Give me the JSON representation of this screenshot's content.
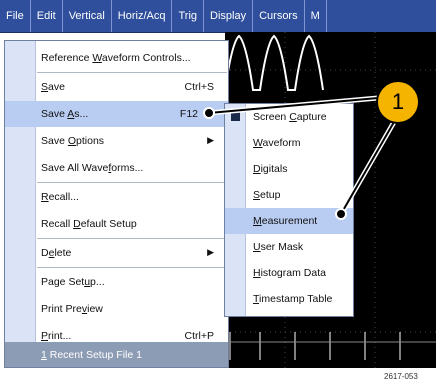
{
  "menubar": {
    "items": [
      "File",
      "Edit",
      "Vertical",
      "Horiz/Acq",
      "Trig",
      "Display",
      "Cursors",
      "M"
    ]
  },
  "file_menu": {
    "items": [
      {
        "pre": "Reference ",
        "u": "W",
        "post": "aveform Controls..."
      },
      {
        "pre": "",
        "u": "S",
        "post": "ave",
        "shortcut": "Ctrl+S"
      },
      {
        "pre": "Save ",
        "u": "A",
        "post": "s...",
        "shortcut": "F12"
      },
      {
        "pre": "Save ",
        "u": "O",
        "post": "ptions"
      },
      {
        "pre": "Save All Wave",
        "u": "f",
        "post": "orms..."
      },
      {
        "pre": "",
        "u": "R",
        "post": "ecall..."
      },
      {
        "pre": "Recall ",
        "u": "D",
        "post": "efault Setup"
      },
      {
        "pre": "D",
        "u": "e",
        "post": "lete"
      },
      {
        "pre": "Page Set",
        "u": "u",
        "post": "p..."
      },
      {
        "pre": "Print Pre",
        "u": "v",
        "post": "iew"
      },
      {
        "pre": "",
        "u": "P",
        "post": "rint...",
        "shortcut": "Ctrl+P"
      },
      {
        "pre": "",
        "u": "1",
        "post": " Recent Setup File 1"
      }
    ]
  },
  "save_as_submenu": {
    "items": [
      {
        "pre": "Screen ",
        "u": "C",
        "post": "apture"
      },
      {
        "pre": "",
        "u": "W",
        "post": "aveform"
      },
      {
        "pre": "",
        "u": "D",
        "post": "igitals"
      },
      {
        "pre": "",
        "u": "S",
        "post": "etup"
      },
      {
        "pre": "",
        "u": "M",
        "post": "easurement"
      },
      {
        "pre": "",
        "u": "U",
        "post": "ser Mask"
      },
      {
        "pre": "",
        "u": "H",
        "post": "istogram Data"
      },
      {
        "pre": "",
        "u": "T",
        "post": "imestamp Table"
      }
    ]
  },
  "callout": {
    "number": "1"
  },
  "caption": "2617-053",
  "colors": {
    "menubar": "#2f4f9c",
    "highlight": "#b9cdf2",
    "callout": "#f5b400"
  }
}
